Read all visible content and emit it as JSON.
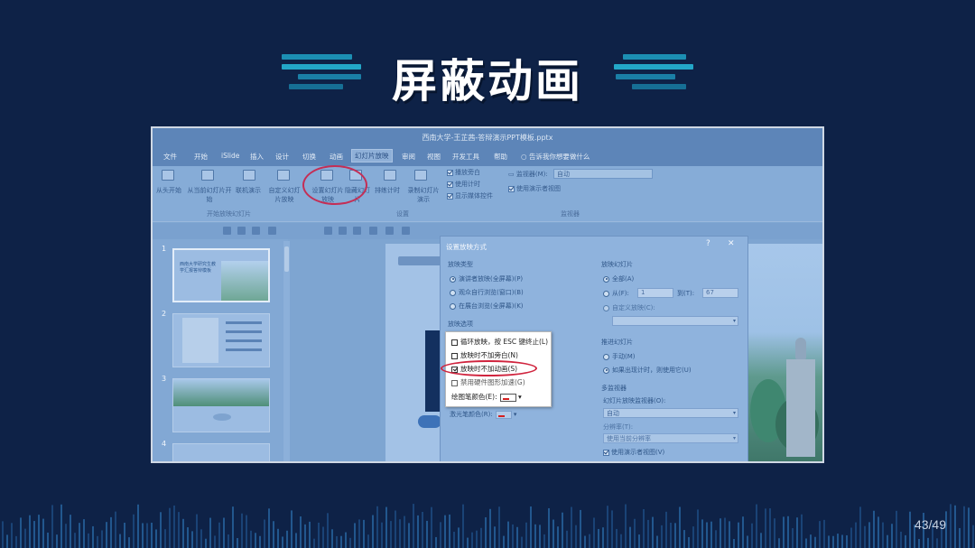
{
  "slide": {
    "title": "屏蔽动画",
    "page_number": "43/49",
    "colors": {
      "background": "#0e2247",
      "accent": "#1fa3c4",
      "highlight": "#d0243e"
    }
  },
  "ppt": {
    "doc_title": "西南大学-王芷茜-答辩演示PPT模板.pptx",
    "menu": [
      "文件",
      "开始",
      "iSlide",
      "插入",
      "设计",
      "切换",
      "动画",
      "幻灯片放映",
      "审阅",
      "视图",
      "开发工具",
      "帮助"
    ],
    "menu_active": "幻灯片放映",
    "tell_me": "告诉我你想要做什么",
    "ribbon": {
      "buttons": [
        {
          "label": "从头开始",
          "icon": "play-from-start-icon"
        },
        {
          "label": "从当前幻灯片开始",
          "icon": "play-from-current-icon"
        },
        {
          "label": "联机演示",
          "icon": "present-online-icon"
        },
        {
          "label": "自定义幻灯片放映",
          "icon": "custom-show-icon"
        },
        {
          "label": "设置幻灯片放映",
          "icon": "setup-show-icon"
        },
        {
          "label": "隐藏幻灯片",
          "icon": "hide-slide-icon"
        },
        {
          "label": "排练计时",
          "icon": "rehearse-icon"
        },
        {
          "label": "录制幻灯片演示",
          "icon": "record-icon"
        }
      ],
      "groups": [
        "开始放映幻灯片",
        "设置",
        "监视器"
      ],
      "checks": [
        {
          "label": "播放旁白",
          "checked": true
        },
        {
          "label": "使用计时",
          "checked": true
        },
        {
          "label": "显示媒体控件",
          "checked": true
        }
      ],
      "monitor_label": "监视器(M):",
      "monitor_value": "自动",
      "presenter_view": "使用演示者视图"
    },
    "slide_numbers": [
      "1",
      "2",
      "3",
      "4"
    ],
    "thumb1_text": "西南大学研究生教学汇报答辩模板"
  },
  "dialog": {
    "title": "设置放映方式",
    "help": "?",
    "close": "✕",
    "show_type": {
      "label": "放映类型",
      "options": [
        {
          "label": "演讲者放映(全屏幕)(P)",
          "selected": true
        },
        {
          "label": "观众自行浏览(窗口)(B)",
          "selected": false
        },
        {
          "label": "在展台浏览(全屏幕)(K)",
          "selected": false
        }
      ]
    },
    "show_options_label": "放映选项",
    "show_slides": {
      "label": "放映幻灯片",
      "all": "全部(A)",
      "from": "从(F):",
      "from_value": "1",
      "to": "到(T):",
      "to_value": "67",
      "custom": "自定义放映(C):"
    },
    "advance": {
      "label": "推进幻灯片",
      "manual": "手动(M)",
      "timing": "如果出现计时，则使用它(U)"
    },
    "multi_monitor": {
      "label": "多监视器",
      "monitor_label": "幻灯片放映监视器(O):",
      "monitor_value": "自动",
      "resolution_label": "分辨率(T):",
      "resolution_value": "使用当前分辨率",
      "presenter_view": "使用演示者视图(V)"
    },
    "laser_label": "激光笔颜色(R):"
  },
  "popup": {
    "options": [
      {
        "label": "循环放映，按 ESC 键终止(L)",
        "checked": false
      },
      {
        "label": "放映时不加旁白(N)",
        "checked": false
      },
      {
        "label": "放映时不加动画(S)",
        "checked": true
      },
      {
        "label": "禁用硬件图形加速(G)",
        "checked": false
      }
    ],
    "pen_label": "绘图笔颜色(E):"
  }
}
